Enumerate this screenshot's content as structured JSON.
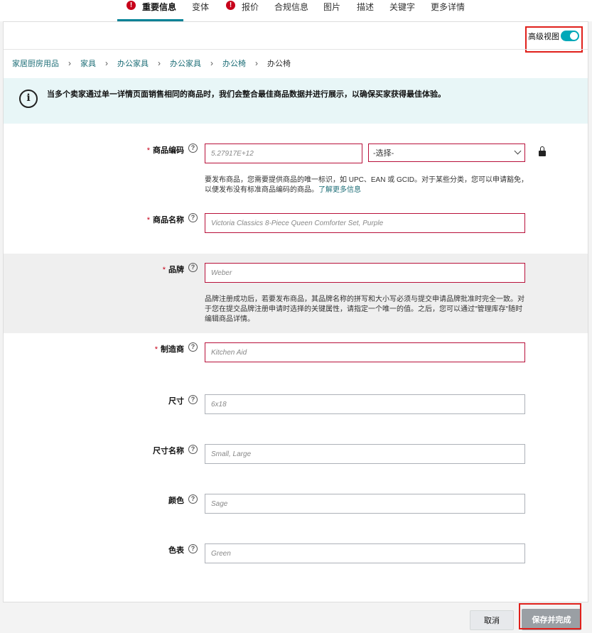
{
  "tabs": [
    {
      "label": "重要信息",
      "error": true,
      "active": true
    },
    {
      "label": "变体",
      "error": false,
      "active": false
    },
    {
      "label": "报价",
      "error": true,
      "active": false
    },
    {
      "label": "合规信息",
      "error": false,
      "active": false
    },
    {
      "label": "图片",
      "error": false,
      "active": false
    },
    {
      "label": "描述",
      "error": false,
      "active": false
    },
    {
      "label": "关键字",
      "error": false,
      "active": false
    },
    {
      "label": "更多详情",
      "error": false,
      "active": false
    }
  ],
  "error_glyph": "!",
  "advanced_view": {
    "label": "高级视图",
    "on": true
  },
  "breadcrumb": [
    "家居厨房用品",
    "家具",
    "办公家具",
    "办公家具",
    "办公椅",
    "办公椅"
  ],
  "breadcrumb_sep": "›",
  "info": {
    "icon": "info-icon",
    "glyph": "i",
    "text": "当多个卖家通过单一详情页面销售相同的商品时，我们会整合最佳商品数据并进行展示，以确保买家获得最佳体验。"
  },
  "help_glyph": "?",
  "required_mark": "*",
  "fields": {
    "product_id": {
      "label": "商品编码",
      "required": true,
      "value": "5.27917E+12",
      "select_value": "-选择-",
      "help_text": "要发布商品，您需要提供商品的唯一标识，如 UPC、EAN 或 GCID。对于某些分类，您可以申请豁免，以便发布没有标准商品编码的商品。",
      "help_link": "了解更多信息"
    },
    "product_name": {
      "label": "商品名称",
      "required": true,
      "value": "Victoria Classics 8-Piece Queen Comforter Set, Purple"
    },
    "brand": {
      "label": "品牌",
      "required": true,
      "value": "Weber",
      "help_text": "品牌注册成功后，若要发布商品，其品牌名称的拼写和大小写必须与提交申请品牌批准时完全一致。对于您在提交品牌注册申请时选择的关键属性，请指定一个唯一的值。之后，您可以通过\"管理库存\"随时编辑商品详情。"
    },
    "manufacturer": {
      "label": "制造商",
      "required": true,
      "value": "Kitchen Aid"
    },
    "size": {
      "label": "尺寸",
      "required": false,
      "value": "6x18"
    },
    "size_name": {
      "label": "尺寸名称",
      "required": false,
      "value": "Small, Large"
    },
    "color": {
      "label": "颜色",
      "required": false,
      "value": "Sage"
    },
    "color_map": {
      "label": "色表",
      "required": false,
      "value": "Green"
    }
  },
  "buttons": {
    "cancel": "取消",
    "save": "保存并完成"
  },
  "colors": {
    "accent": "#008296",
    "error": "#c7011a",
    "toggle_on": "#00a8b8",
    "highlight": "#e0201b"
  }
}
